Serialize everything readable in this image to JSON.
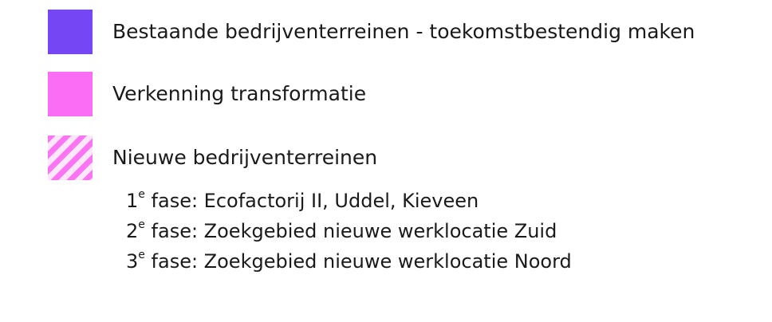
{
  "legend": {
    "items": [
      {
        "label": "Bestaande bedrijventerreinen - toekomstbestendig maken",
        "color": "#7446f4",
        "pattern": "solid"
      },
      {
        "label": "Verkenning transformatie",
        "color": "#fb6df5",
        "pattern": "solid"
      },
      {
        "label": "Nieuwe bedrijventerreinen",
        "color": "#fb74f3",
        "pattern": "diagonal-hatch"
      }
    ],
    "phases": [
      {
        "number": "1",
        "suffix": "e",
        "text": " fase: Ecofactorij II, Uddel, Kieveen"
      },
      {
        "number": "2",
        "suffix": "e",
        "text": " fase: Zoekgebied nieuwe werklocatie Zuid"
      },
      {
        "number": "3",
        "suffix": "e",
        "text": " fase: Zoekgebied nieuwe werklocatie Noord"
      }
    ]
  }
}
